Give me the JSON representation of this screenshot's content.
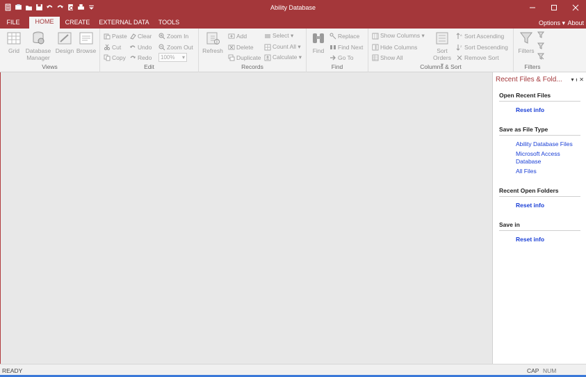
{
  "window": {
    "title": "Ability Database"
  },
  "tabs": [
    {
      "label": "FILE"
    },
    {
      "label": "HOME"
    },
    {
      "label": "CREATE"
    },
    {
      "label": "EXTERNAL DATA"
    },
    {
      "label": "TOOLS"
    }
  ],
  "menu": {
    "options": "Options ▾",
    "about": "About"
  },
  "ribbon": {
    "views": {
      "label": "Views",
      "grid": "Grid",
      "db_manager_1": "Database",
      "db_manager_2": "Manager",
      "design": "Design",
      "browse": "Browse"
    },
    "edit": {
      "label": "Edit",
      "paste": "Paste",
      "cut": "Cut",
      "copy": "Copy",
      "clear": "Clear",
      "undo": "Undo",
      "redo": "Redo",
      "zoom_in": "Zoom In",
      "zoom_out": "Zoom Out",
      "zoom_value": "100%"
    },
    "records": {
      "label": "Records",
      "refresh": "Refresh",
      "add": "Add",
      "delete": "Delete",
      "duplicate": "Duplicate",
      "select": "Select ▾",
      "count_all": "Count All ▾",
      "calculate": "Calculate ▾"
    },
    "find": {
      "label": "Find",
      "find": "Find",
      "replace": "Replace",
      "find_next": "Find Next",
      "go_to": "Go To"
    },
    "columns_sort": {
      "label": "Columns & Sort",
      "show_columns": "Show Columns ▾",
      "hide_columns": "Hide Columns",
      "show_all": "Show All",
      "sort_orders_1": "Sort",
      "sort_orders_2": "Orders ▾",
      "sort_asc": "Sort Ascending",
      "sort_desc": "Sort Descending",
      "remove_sort": "Remove Sort"
    },
    "filters": {
      "label": "Filters",
      "filters": "Filters"
    }
  },
  "panel": {
    "title": "Recent Files & Fold...",
    "sections": {
      "open_recent": {
        "heading": "Open Recent Files",
        "reset": "Reset info"
      },
      "save_type": {
        "heading": "Save as File Type",
        "links": [
          "Ability Database Files",
          "Microsoft Access",
          "Database",
          "All Files"
        ]
      },
      "recent_folders": {
        "heading": "Recent Open Folders",
        "reset": "Reset info"
      },
      "save_in": {
        "heading": "Save in",
        "reset": "Reset info"
      }
    }
  },
  "status": {
    "text": "READY",
    "cap": "CAP",
    "num": "NUM"
  },
  "colors": {
    "accent": "#a4373a",
    "link": "#1a3fd6"
  }
}
